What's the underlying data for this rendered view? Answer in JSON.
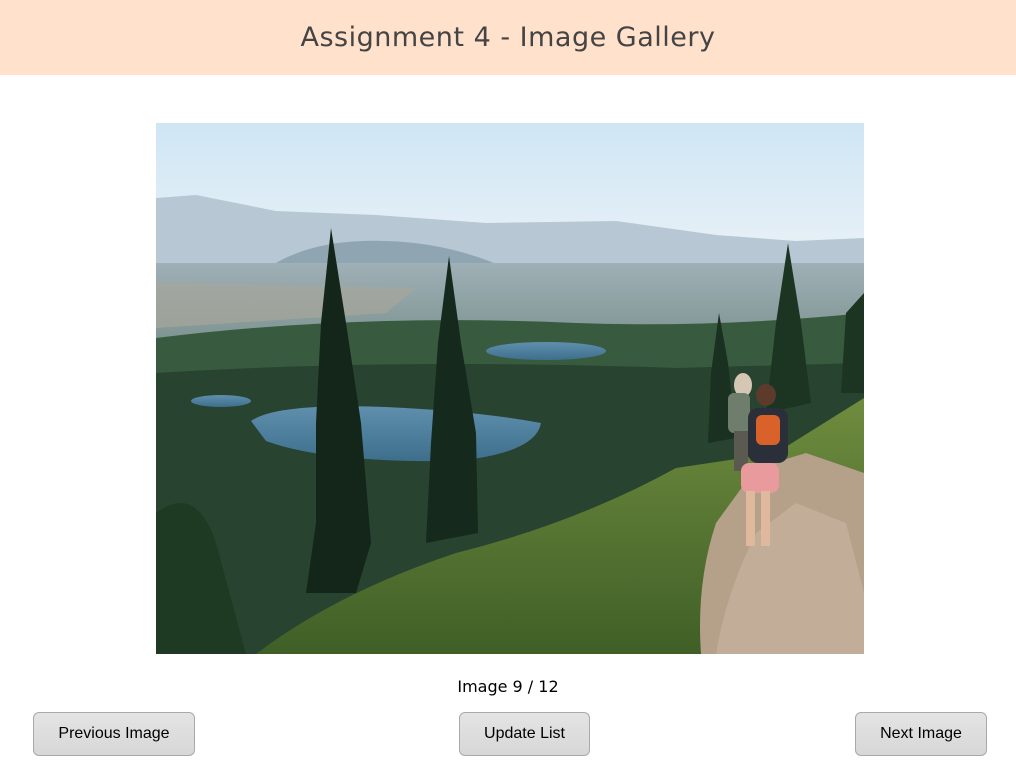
{
  "header": {
    "title": "Assignment 4 - Image Gallery"
  },
  "gallery": {
    "image_alt": "Hikers on a mountain trail overlooking forested valley with lakes",
    "counter": "Image 9 / 12"
  },
  "buttons": {
    "previous": "Previous Image",
    "update": "Update List",
    "next": "Next Image"
  },
  "colors": {
    "header_bg": "#ffe1cc",
    "button_bg": "#dcdcdc"
  }
}
